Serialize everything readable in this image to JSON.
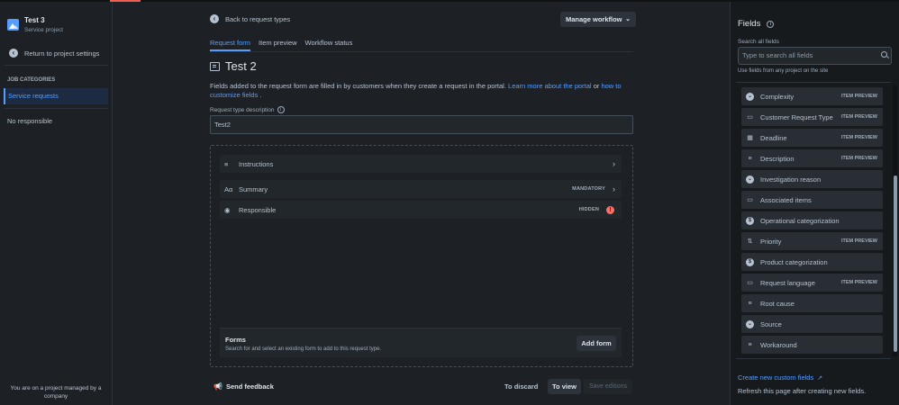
{
  "project": {
    "name": "Test 3",
    "type": "Service project"
  },
  "sidebar": {
    "return_label": "Return to project settings",
    "section_heading": "JOB CATEGORIES",
    "active_item": "Service requests",
    "no_responsible": "No responsible",
    "managed_note": "You are on a project managed by a company"
  },
  "header": {
    "back_label": "Back to request types",
    "manage_workflow": "Manage workflow",
    "tabs": [
      {
        "label": "Request form",
        "active": true
      },
      {
        "label": "Item preview",
        "active": false
      },
      {
        "label": "Workflow status",
        "active": false
      }
    ]
  },
  "form": {
    "title": "Test 2",
    "desc_text": "Fields added to the request form are filled in by customers when they create a request in the portal.",
    "desc_link1": "Learn more about the portal",
    "desc_or": "or",
    "desc_link2": "how to customize fields",
    "desc_end": ".",
    "rtd_label": "Request type description",
    "rtd_value": "Test2",
    "rows": [
      {
        "icon": "instructions-icon",
        "glyph": "≡",
        "label": "Instructions",
        "badge": ""
      },
      {
        "icon": "summary-icon",
        "glyph": "Aα",
        "label": "Summary",
        "badge": "MANDATORY"
      },
      {
        "icon": "person-icon",
        "glyph": "◉",
        "label": "Responsible",
        "badge": "HIDDEN"
      }
    ],
    "forms_title": "Forms",
    "forms_sub": "Search for and select an existing form to add to this request type.",
    "add_form": "Add form"
  },
  "footer": {
    "feedback": "Send feedback",
    "discard": "To discard",
    "to_view": "To view",
    "save": "Save editions"
  },
  "fields_panel": {
    "title": "Fields",
    "search_label": "Search all fields",
    "search_placeholder": "Type to search all fields",
    "use_fields": "Use fields from any project on the site",
    "items": [
      {
        "label": "Complexity",
        "icon": "dropdown-icon",
        "badge": "ITEM PREVIEW"
      },
      {
        "label": "Customer Request Type",
        "icon": "folder-icon",
        "badge": "ITEM PREVIEW"
      },
      {
        "label": "Deadline",
        "icon": "calendar-icon",
        "badge": "ITEM PREVIEW"
      },
      {
        "label": "Description",
        "icon": "paragraph-icon",
        "badge": "ITEM PREVIEW"
      },
      {
        "label": "Investigation reason",
        "icon": "dropdown-icon",
        "badge": ""
      },
      {
        "label": "Associated items",
        "icon": "folder-icon",
        "badge": ""
      },
      {
        "label": "Operational categorization",
        "icon": "category-icon",
        "badge": ""
      },
      {
        "label": "Priority",
        "icon": "priority-icon",
        "badge": "ITEM PREVIEW"
      },
      {
        "label": "Product categorization",
        "icon": "category-icon",
        "badge": ""
      },
      {
        "label": "Request language",
        "icon": "folder-icon",
        "badge": "ITEM PREVIEW"
      },
      {
        "label": "Root cause",
        "icon": "paragraph-icon",
        "badge": ""
      },
      {
        "label": "Source",
        "icon": "dropdown-icon",
        "badge": ""
      },
      {
        "label": "Workaround",
        "icon": "paragraph-icon",
        "badge": ""
      }
    ],
    "create_link": "Create new custom fields",
    "refresh_note": "Refresh this page after creating new fields."
  }
}
